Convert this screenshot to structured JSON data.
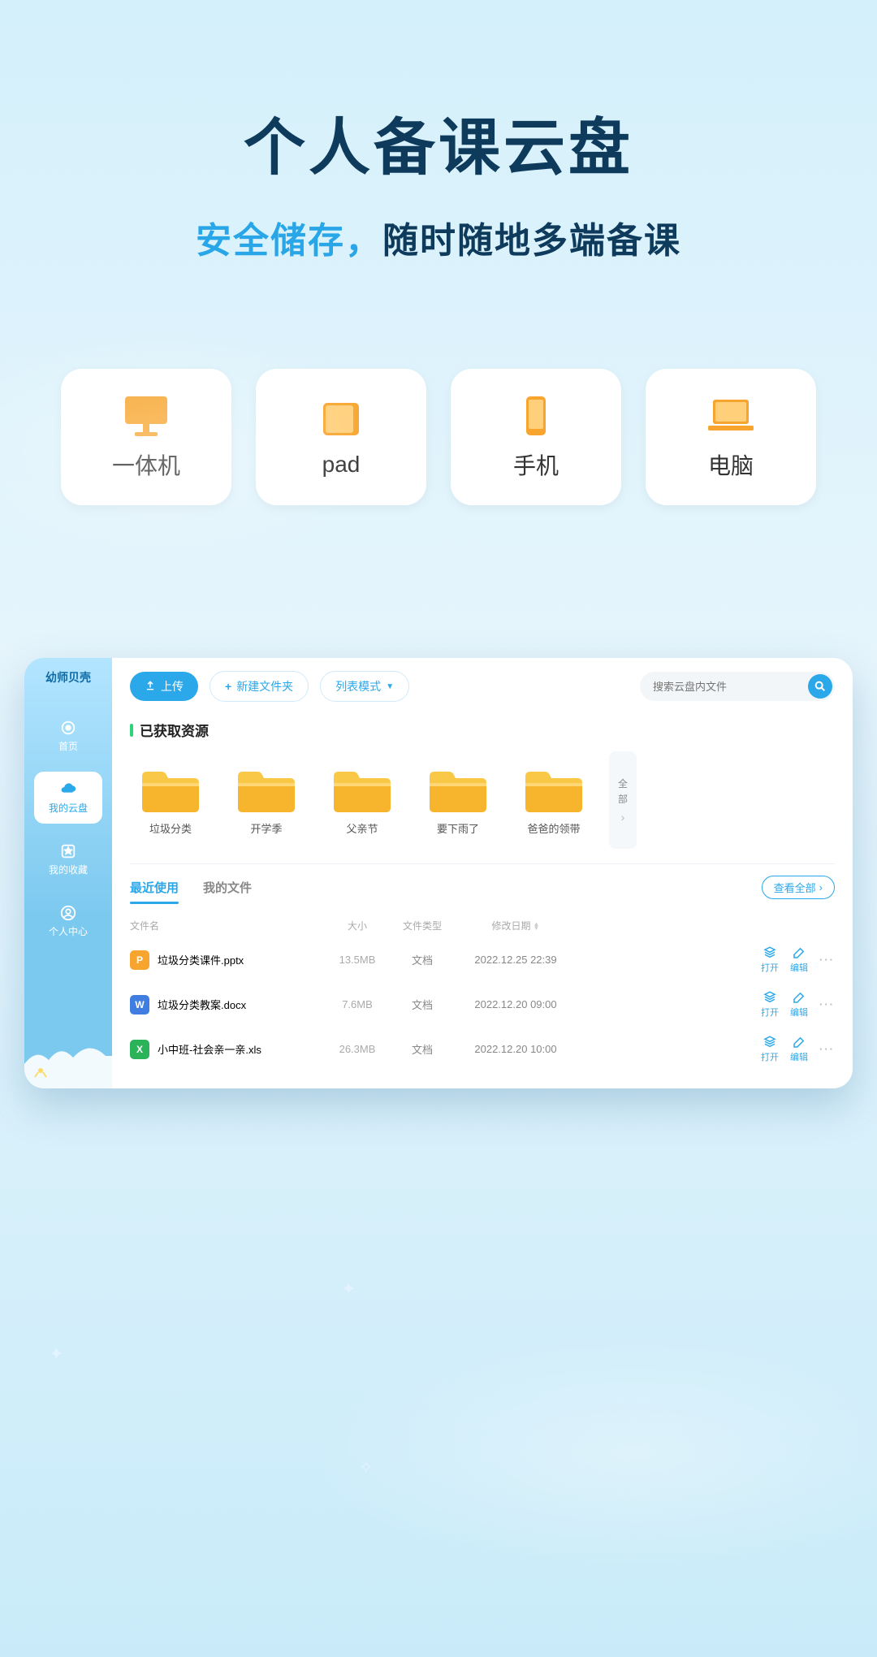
{
  "hero": {
    "title": "个人备课云盘",
    "subtitle_accent": "安全储存，",
    "subtitle_rest": "随时随地多端备课"
  },
  "devices": [
    {
      "label": "一体机",
      "icon": "monitor"
    },
    {
      "label": "pad",
      "icon": "tablet"
    },
    {
      "label": "手机",
      "icon": "phone"
    },
    {
      "label": "电脑",
      "icon": "laptop"
    }
  ],
  "app": {
    "logo": "幼师贝壳",
    "sidebar": [
      {
        "label": "首页",
        "icon": "home",
        "active": false
      },
      {
        "label": "我的云盘",
        "icon": "cloud",
        "active": true
      },
      {
        "label": "我的收藏",
        "icon": "star",
        "active": false
      },
      {
        "label": "个人中心",
        "icon": "user",
        "active": false
      }
    ],
    "toolbar": {
      "upload": "上传",
      "new_folder": "新建文件夹",
      "view_mode": "列表模式"
    },
    "search": {
      "placeholder": "搜索云盘内文件"
    },
    "section_resources": "已获取资源",
    "folders": [
      {
        "name": "垃圾分类"
      },
      {
        "name": "开学季"
      },
      {
        "name": "父亲节"
      },
      {
        "name": "要下雨了"
      },
      {
        "name": "爸爸的领带"
      }
    ],
    "all_button": {
      "l1": "全",
      "l2": "部"
    },
    "tabs": {
      "recent": "最近使用",
      "my_files": "我的文件"
    },
    "view_all": "查看全部",
    "table": {
      "headers": {
        "name": "文件名",
        "size": "大小",
        "type": "文件类型",
        "date": "修改日期"
      },
      "actions": {
        "open": "打开",
        "edit": "编辑"
      },
      "rows": [
        {
          "icon": "p",
          "name": "垃圾分类课件.pptx",
          "size": "13.5MB",
          "type": "文档",
          "date": "2022.12.25 22:39"
        },
        {
          "icon": "w",
          "name": "垃圾分类教案.docx",
          "size": "7.6MB",
          "type": "文档",
          "date": "2022.12.20 09:00"
        },
        {
          "icon": "x",
          "name": "小中班-社会亲一亲.xls",
          "size": "26.3MB",
          "type": "文档",
          "date": "2022.12.20 10:00"
        }
      ]
    }
  }
}
